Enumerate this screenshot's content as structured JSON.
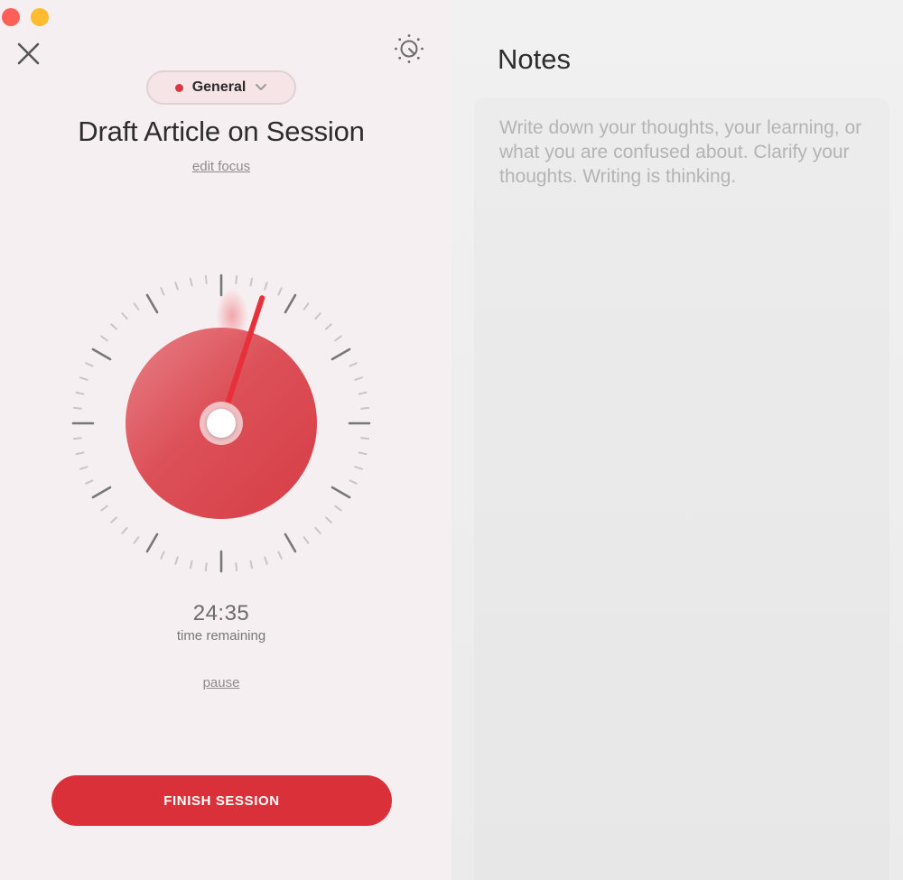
{
  "window": {
    "controls": [
      "close",
      "minimize"
    ]
  },
  "header": {
    "close_icon": "close-x-icon",
    "theme_icon": "sun-moon-icon"
  },
  "session": {
    "category": "General",
    "category_color": "#d83a44",
    "title": "Draft Article on Session",
    "edit_focus_label": "edit focus",
    "time_remaining_value": "24:35",
    "time_remaining_label": "time remaining",
    "pause_label": "pause",
    "finish_label": "FINISH SESSION",
    "accent_color": "#d93039",
    "elapsed_fraction": 0.0167
  },
  "notes": {
    "title": "Notes",
    "placeholder": "Write down your thoughts, your learning, or what you are confused about. Clarify your thoughts. Writing is thinking.",
    "value": ""
  }
}
